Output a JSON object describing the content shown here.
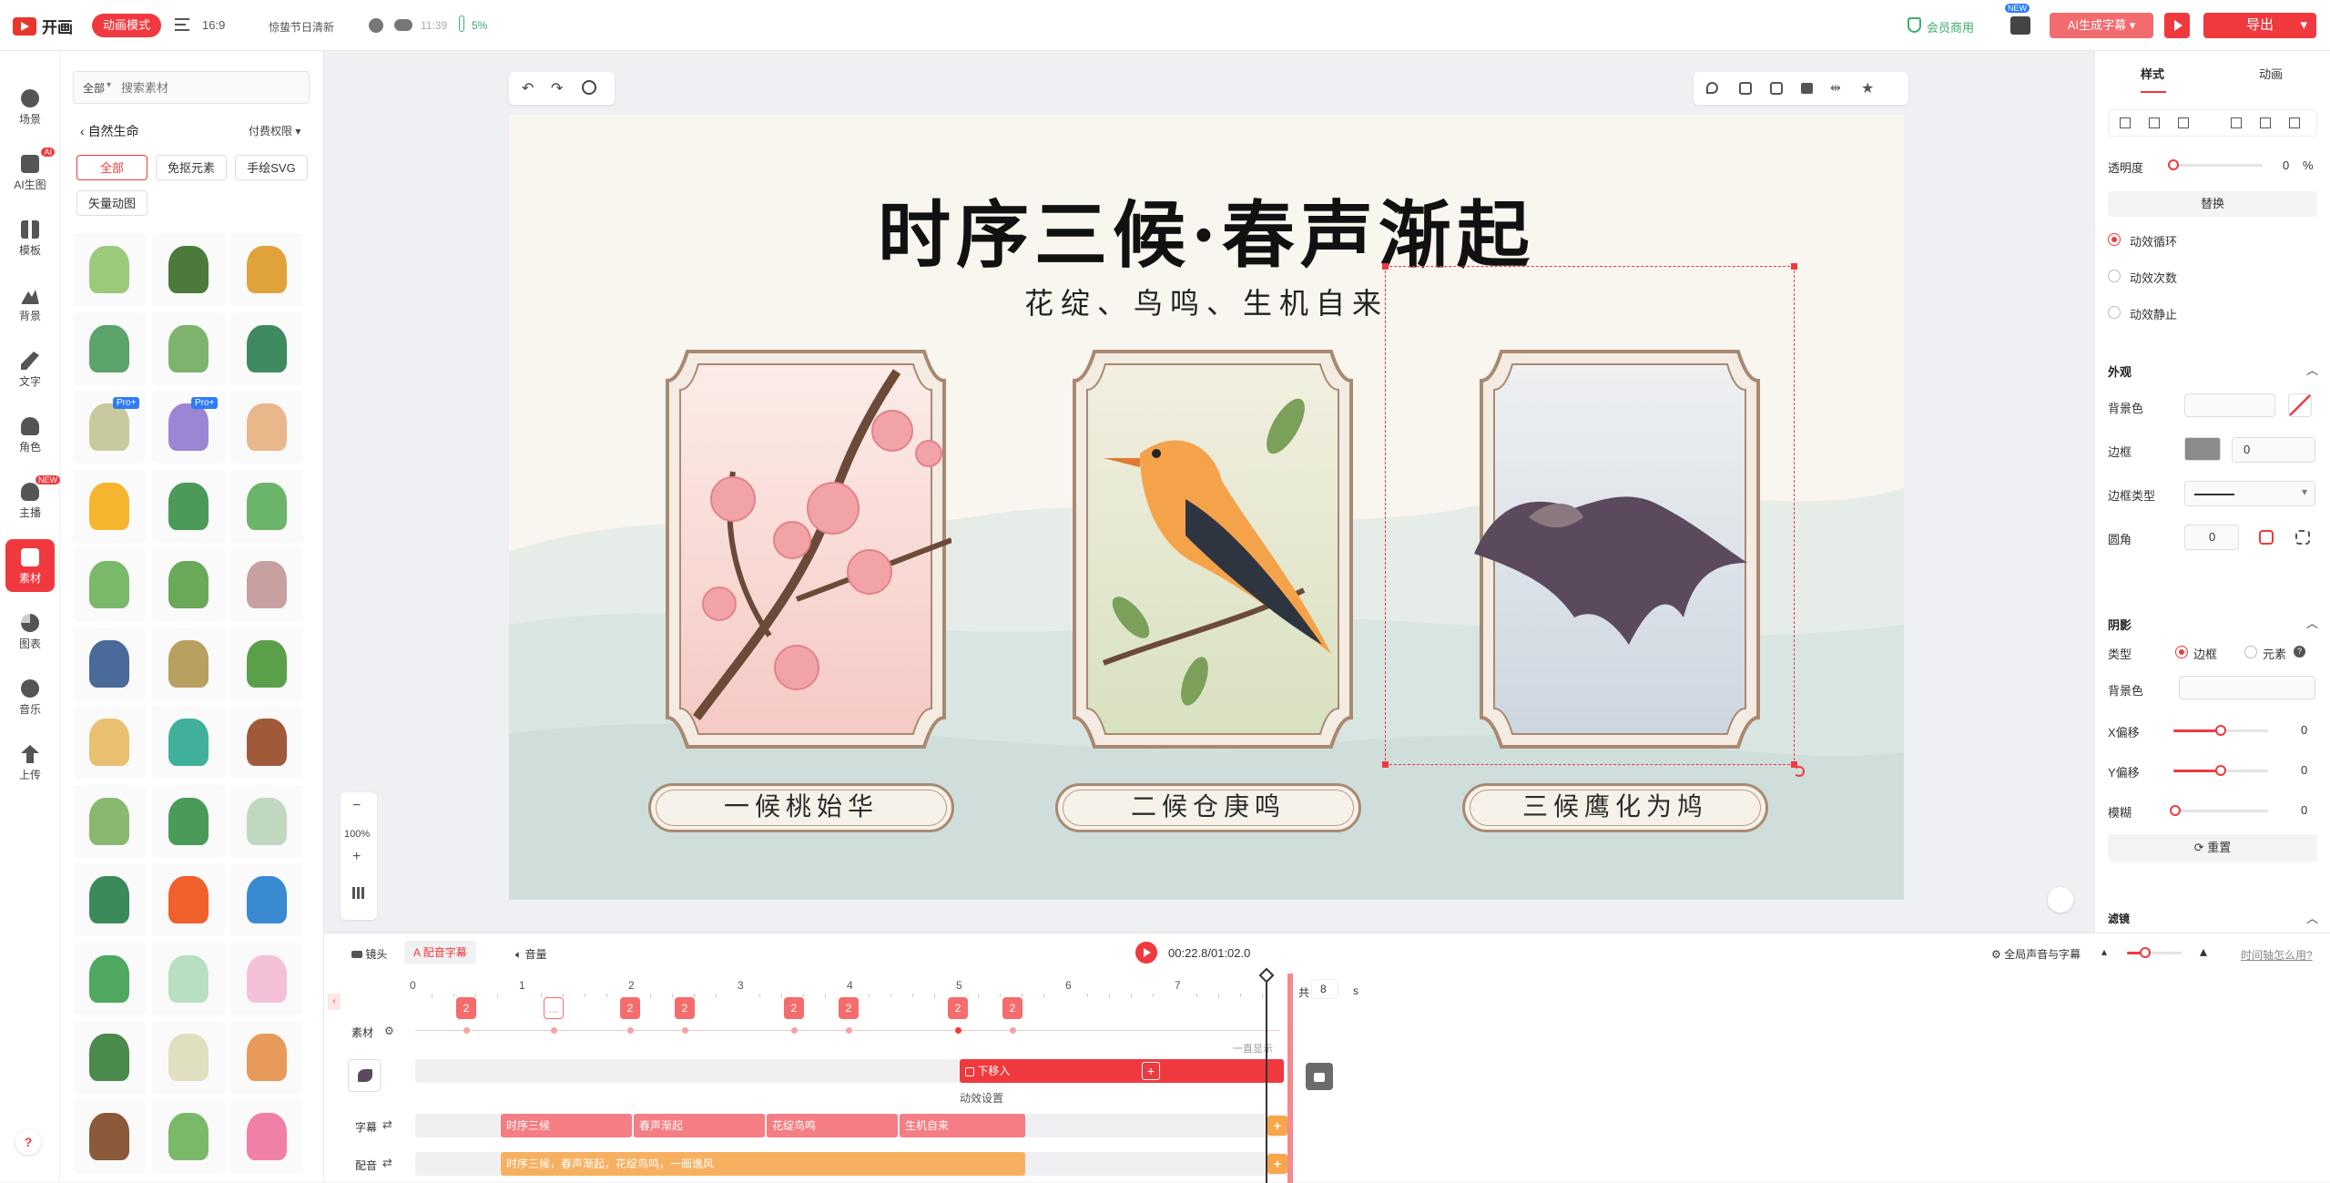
{
  "topbar": {
    "logo": "开画",
    "mode_badge": "动画模式",
    "ratio": "16:9",
    "project_name": "惊蛰节日清新",
    "save_time": "11:39",
    "battery": "5%",
    "member": "会员商用",
    "new_badge": "NEW",
    "ai_generate": "AI生成字幕",
    "export": "导出"
  },
  "rail": [
    {
      "label": "场景",
      "icon": "scene-icon"
    },
    {
      "label": "AI生图",
      "icon": "ai-image-icon",
      "badge": "AI"
    },
    {
      "label": "模板",
      "icon": "template-icon"
    },
    {
      "label": "背景",
      "icon": "background-icon"
    },
    {
      "label": "文字",
      "icon": "text-icon"
    },
    {
      "label": "角色",
      "icon": "character-icon"
    },
    {
      "label": "主播",
      "icon": "anchor-icon",
      "badge": "NEW"
    },
    {
      "label": "素材",
      "icon": "material-icon",
      "active": true
    },
    {
      "label": "图表",
      "icon": "chart-icon"
    },
    {
      "label": "音乐",
      "icon": "music-icon"
    },
    {
      "label": "上传",
      "icon": "upload-icon"
    }
  ],
  "assets": {
    "scope": "全部",
    "search_placeholder": "搜索素材",
    "category": "自然生命",
    "permission": "付费权限",
    "tags": [
      "全部",
      "免抠元素",
      "手绘SVG",
      "矢量动图"
    ],
    "pro_badge": "Pro+"
  },
  "canvas": {
    "zoom": "100%",
    "title": "时序三候·春声渐起",
    "subtitle": "花绽、鸟鸣、生机自来",
    "labels": [
      "一候桃始华",
      "二候仓庚鸣",
      "三候鹰化为鸠"
    ]
  },
  "props": {
    "tabs": [
      "样式",
      "动画"
    ],
    "opacity_label": "透明度",
    "opacity_value": "0",
    "opacity_unit": "%",
    "replace": "替换",
    "loop_options": [
      "动效循环",
      "动效次数",
      "动效静止"
    ],
    "appearance": "外观",
    "bg_color": "背景色",
    "border": "边框",
    "border_value": "0",
    "border_type": "边框类型",
    "radius": "圆角",
    "radius_value": "0",
    "shadow": "阴影",
    "type_label": "类型",
    "type_options": [
      "边框",
      "元素"
    ],
    "shadow_bg": "背景色",
    "x_offset": "X偏移",
    "x_value": "0",
    "y_offset": "Y偏移",
    "y_value": "0",
    "blur": "模糊",
    "blur_value": "0",
    "reset": "重置",
    "filter": "滤镜"
  },
  "timeline": {
    "tabs": [
      "镜头",
      "配音字幕",
      "音量"
    ],
    "time": "00:22.8/01:02.0",
    "global_subtitle": "全局声音与字幕",
    "help": "时间轴怎么用?",
    "total_prefix": "共",
    "total_value": "8",
    "total_unit": "s",
    "ticks": [
      "0",
      "1",
      "2",
      "3",
      "4",
      "5",
      "6",
      "7"
    ],
    "material_label": "素材",
    "marker_num": "2",
    "always_show": "一直显示",
    "anim_chip": "下移入",
    "effect_setting": "动效设置",
    "subtitle_label": "字幕",
    "subtitles": [
      "时序三候",
      "春声渐起",
      "花绽鸟鸣",
      "生机自来"
    ],
    "voice_label": "配音",
    "voice_text": "时序三候，春声渐起，花绽鸟鸣，一画逸风"
  }
}
